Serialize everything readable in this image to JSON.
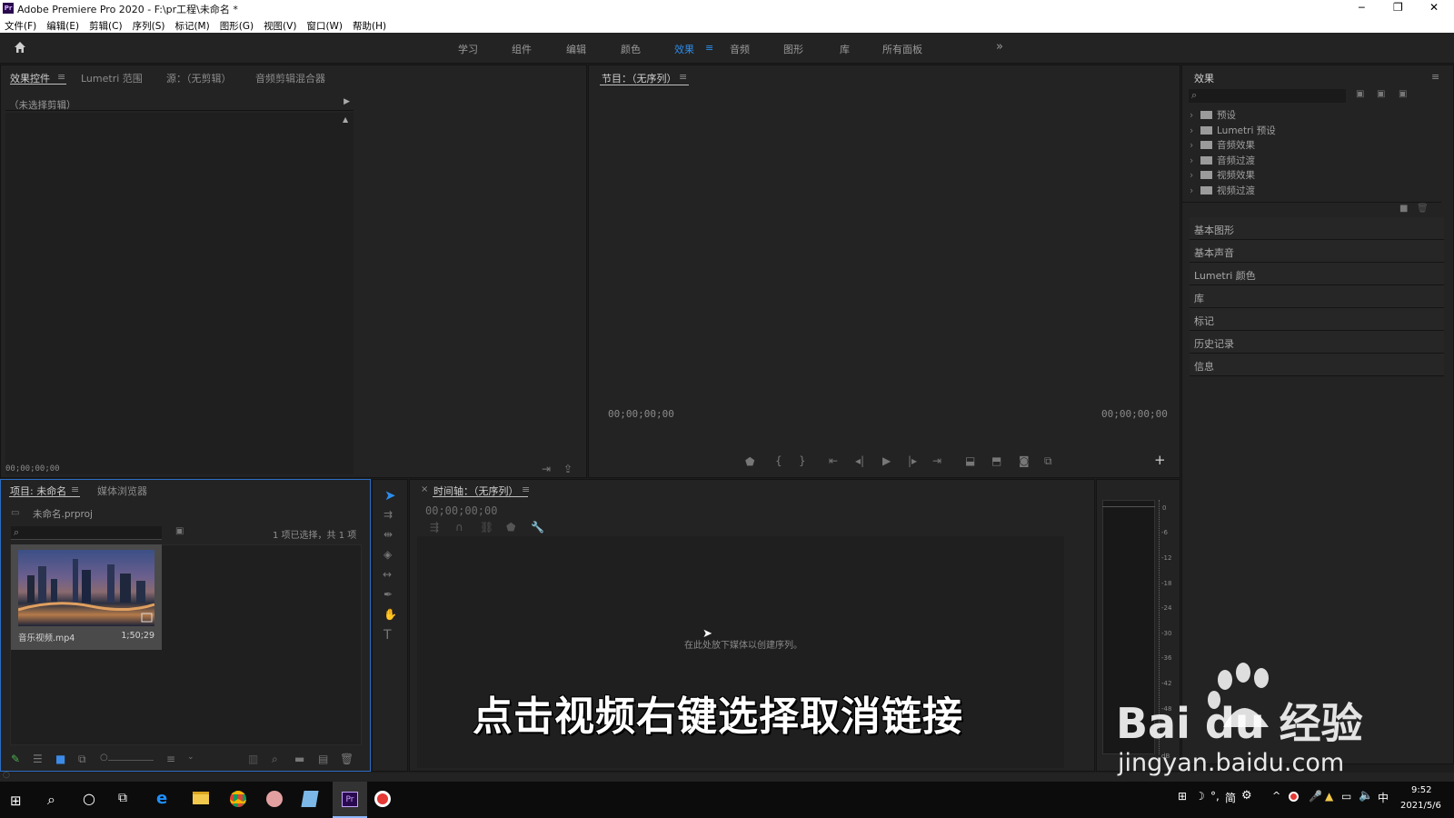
{
  "window": {
    "title": "Adobe Premiere Pro 2020 - F:\\pr工程\\未命名 *",
    "app_badge": "Pr",
    "controls": [
      "─",
      "❐",
      "✕"
    ]
  },
  "menu": [
    "文件(F)",
    "编辑(E)",
    "剪辑(C)",
    "序列(S)",
    "标记(M)",
    "图形(G)",
    "视图(V)",
    "窗口(W)",
    "帮助(H)"
  ],
  "workspaces": [
    "学习",
    "组件",
    "编辑",
    "颜色",
    "效果",
    "音频",
    "图形",
    "库",
    "所有面板"
  ],
  "workspace_active": "效果",
  "effect_controls": {
    "tabs": [
      "效果控件",
      "Lumetri 范围",
      "源：（无剪辑）",
      "音频剪辑混合器"
    ],
    "no_clip": "（未选择剪辑）",
    "timecode": "00;00;00;00"
  },
  "program": {
    "title": "节目：（无序列）",
    "tc_left": "00;00;00;00",
    "tc_right": "00;00;00;00"
  },
  "effects": {
    "title": "效果",
    "tree": [
      "预设",
      "Lumetri 预设",
      "音频效果",
      "音频过渡",
      "视频效果",
      "视频过渡"
    ],
    "collapsed_panels": [
      "基本图形",
      "基本声音",
      "Lumetri 颜色",
      "库",
      "标记",
      "历史记录",
      "信息"
    ]
  },
  "project": {
    "tabs": [
      "项目: 未命名",
      "媒体浏览器"
    ],
    "file": "未命名.prproj",
    "selection": "1 项已选择，共 1 项",
    "clip": {
      "name": "音乐视频.mp4",
      "duration": "1;50;29"
    }
  },
  "timeline": {
    "title": "时间轴：（无序列）",
    "timecode": "00;00;00;00",
    "drop_hint": "在此处放下媒体以创建序列。"
  },
  "meter": {
    "ticks": [
      "0",
      "-6",
      "-12",
      "-18",
      "-24",
      "-30",
      "-36",
      "-42",
      "-48",
      "dB"
    ]
  },
  "caption": "点击视频右键选择取消链接",
  "watermark": {
    "logo": "Bai du 经验",
    "url": "jingyan.baidu.com"
  },
  "taskbar": {
    "time": "9:52",
    "date": "2021/5/6",
    "ime": "中",
    "tray_text": "简"
  }
}
